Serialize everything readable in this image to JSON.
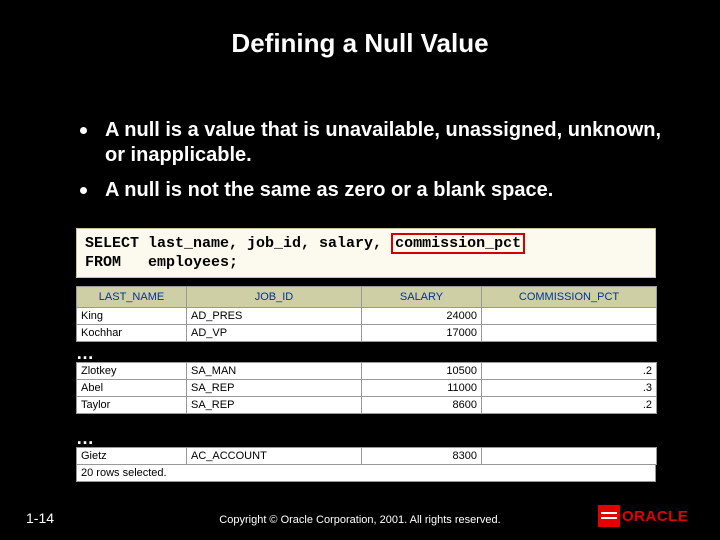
{
  "title": "Defining a Null Value",
  "bullets": [
    "A null is a value that is unavailable, unassigned, unknown, or inapplicable.",
    "A null is not the same as zero or a blank space."
  ],
  "code": {
    "line1_pre": "SELECT last_name, job_id, salary, ",
    "line1_hl": "commission_pct",
    "line2": "FROM   employees;"
  },
  "table": {
    "headers": [
      "LAST_NAME",
      "JOB_ID",
      "SALARY",
      "COMMISSION_PCT"
    ],
    "block1": [
      [
        "King",
        "AD_PRES",
        "24000",
        ""
      ],
      [
        "Kochhar",
        "AD_VP",
        "17000",
        ""
      ]
    ],
    "block2": [
      [
        "Zlotkey",
        "SA_MAN",
        "10500",
        ".2"
      ],
      [
        "Abel",
        "SA_REP",
        "11000",
        ".3"
      ],
      [
        "Taylor",
        "SA_REP",
        "8600",
        ".2"
      ]
    ],
    "block3": [
      [
        "Gietz",
        "AC_ACCOUNT",
        "8300",
        ""
      ]
    ],
    "status": "20 rows selected."
  },
  "ellipsis": "…",
  "footer": {
    "page": "1-14",
    "copyright": "Copyright © Oracle Corporation, 2001. All rights reserved.",
    "logo_word": "ORACLE"
  }
}
